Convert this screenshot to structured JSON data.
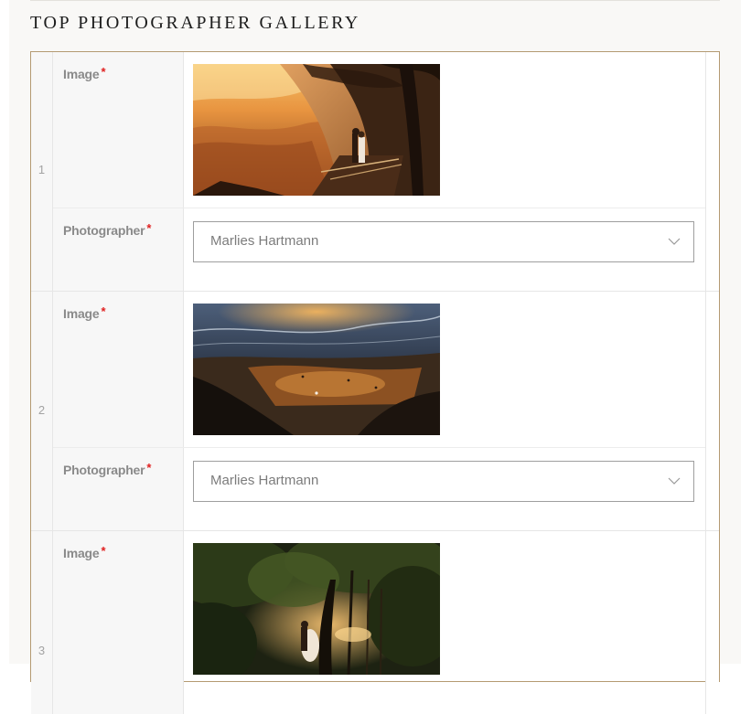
{
  "gallery": {
    "title": "TOP PHOTOGRAPHER GALLERY",
    "required_mark": "*",
    "rows": [
      {
        "number": "1",
        "image_label": "Image",
        "photographer_label": "Photographer",
        "photographer_value": "Marlies Hartmann"
      },
      {
        "number": "2",
        "image_label": "Image",
        "photographer_label": "Photographer",
        "photographer_value": "Marlies Hartmann"
      },
      {
        "number": "3",
        "image_label": "Image"
      }
    ]
  }
}
